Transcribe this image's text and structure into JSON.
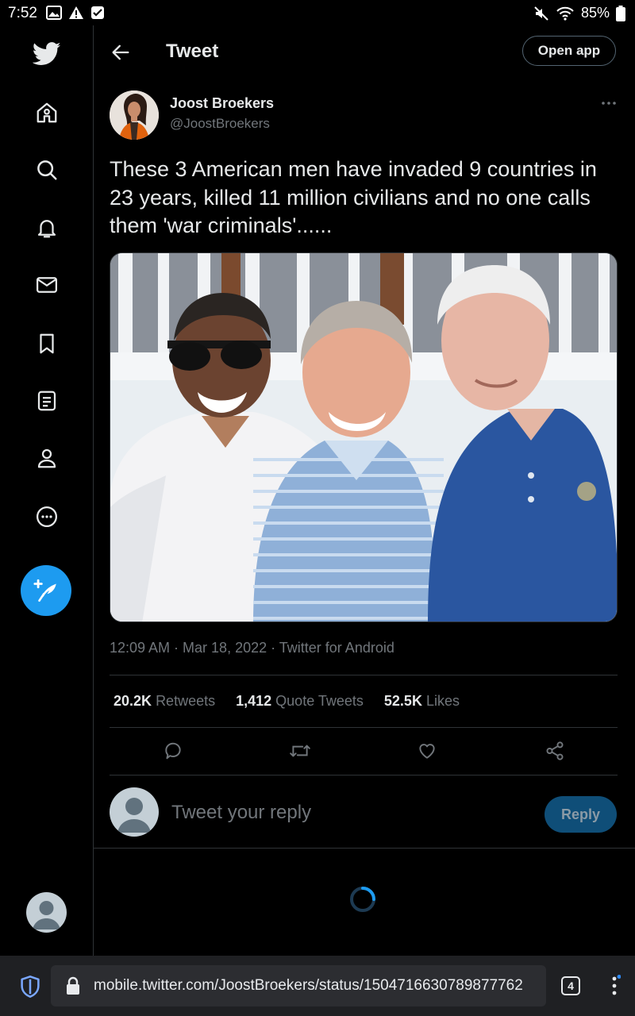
{
  "status_bar": {
    "time": "7:52",
    "battery": "85%",
    "notification_icons": [
      "image-icon",
      "alert-icon",
      "checkbox-icon"
    ],
    "right_icons": [
      "mute-icon",
      "wifi-icon",
      "battery-icon"
    ]
  },
  "sidebar": {
    "items": [
      {
        "name": "home",
        "icon": "home-icon"
      },
      {
        "name": "explore",
        "icon": "search-icon"
      },
      {
        "name": "notifications",
        "icon": "bell-icon"
      },
      {
        "name": "messages",
        "icon": "mail-icon"
      },
      {
        "name": "bookmarks",
        "icon": "bookmark-icon"
      },
      {
        "name": "lists",
        "icon": "list-icon"
      },
      {
        "name": "profile",
        "icon": "person-icon"
      },
      {
        "name": "more",
        "icon": "more-circle-icon"
      }
    ],
    "compose_icon": "feather-plus-icon"
  },
  "header": {
    "title": "Tweet",
    "open_app_label": "Open app"
  },
  "tweet": {
    "author_name": "Joost Broekers",
    "author_handle": "@JoostBroekers",
    "text": "These 3 American men have invaded 9 countries in 23 years, killed 11 million civilians and no one calls them 'war criminals'......",
    "meta": "12:09 AM · Mar 18, 2022 · Twitter for Android",
    "stats": {
      "retweets_count": "20.2K",
      "retweets_label": "Retweets",
      "quotes_count": "1,412",
      "quotes_label": "Quote Tweets",
      "likes_count": "52.5K",
      "likes_label": "Likes"
    }
  },
  "reply": {
    "placeholder": "Tweet your reply",
    "button_label": "Reply"
  },
  "browser": {
    "url": "mobile.twitter.com/JoostBroekers/status/1504716630789877762",
    "tab_count": "4"
  },
  "colors": {
    "background": "#000000",
    "accent": "#1d9bf0",
    "divider": "#2f3336",
    "secondary_text": "#71767b"
  }
}
